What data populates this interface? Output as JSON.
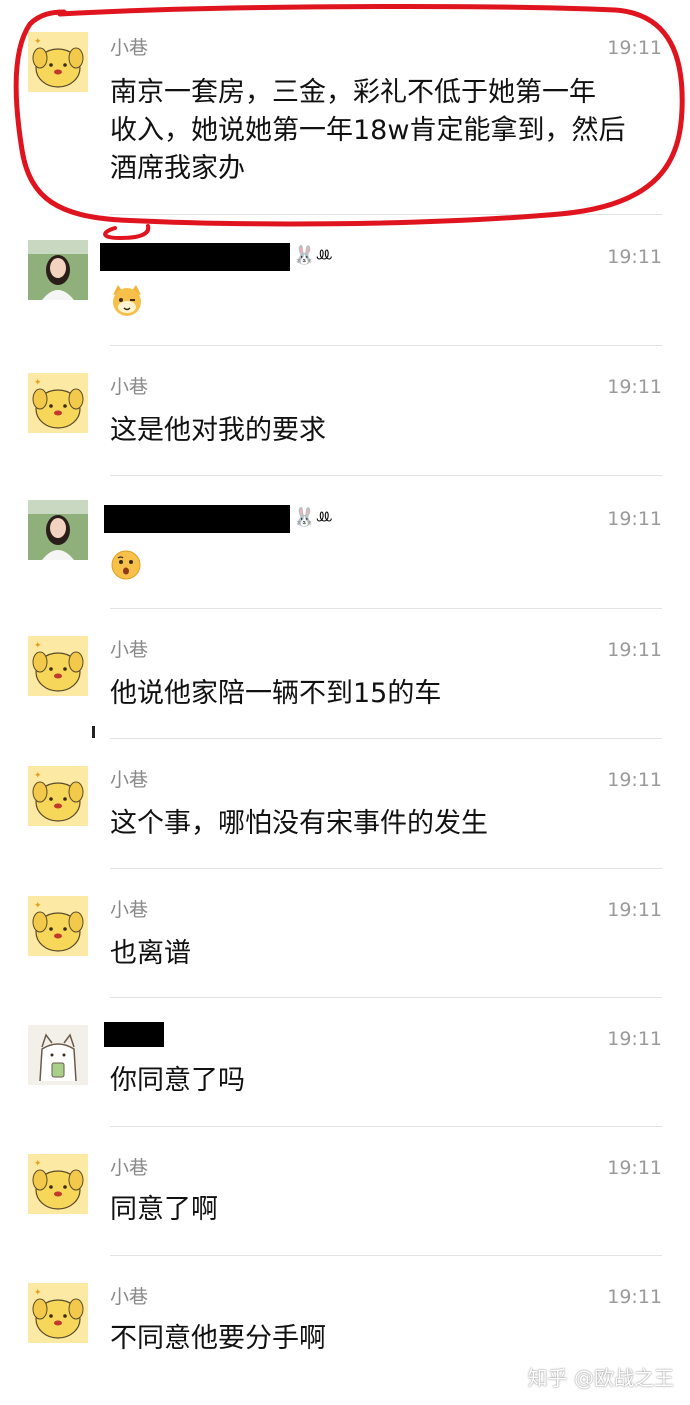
{
  "colors": {
    "annotation_red": "#e0141e",
    "sender_gray": "#8a8a8a",
    "time_gray": "#9a9a9a",
    "text": "#111111",
    "divider": "#e3e3e3"
  },
  "messages": [
    {
      "sender": "小巷",
      "time": "19:11",
      "lines": [
        "南京一套房，三金，彩礼不低于她第一年",
        "收入，她说她第一年18w肯定能拿到，然后",
        "酒席我家办"
      ],
      "avatar": "yellow-dog-avatar"
    },
    {
      "sender": "",
      "time": "19:11",
      "emoji": "cat-face-emoji",
      "avatar": "girl-photo-avatar",
      "name_tag": "🐰ꔛ"
    },
    {
      "sender": "小巷",
      "time": "19:11",
      "lines": [
        "这是他对我的要求"
      ],
      "avatar": "yellow-dog-avatar"
    },
    {
      "sender": "",
      "time": "19:11",
      "emoji": "surprised-face-emoji",
      "avatar": "girl-photo-avatar",
      "name_tag": "🐰ꔛ"
    },
    {
      "sender": "小巷",
      "time": "19:11",
      "lines": [
        "他说他家陪一辆不到15的车"
      ],
      "avatar": "yellow-dog-avatar"
    },
    {
      "sender": "小巷",
      "time": "19:11",
      "lines": [
        "这个事，哪怕没有宋事件的发生"
      ],
      "avatar": "yellow-dog-avatar"
    },
    {
      "sender": "小巷",
      "time": "19:11",
      "lines": [
        "也离谱"
      ],
      "avatar": "yellow-dog-avatar"
    },
    {
      "sender": "",
      "time": "19:11",
      "lines": [
        "你同意了吗"
      ],
      "avatar": "sketch-cat-avatar"
    },
    {
      "sender": "小巷",
      "time": "19:11",
      "lines": [
        "同意了啊"
      ],
      "avatar": "yellow-dog-avatar"
    },
    {
      "sender": "小巷",
      "time": "19:11",
      "lines": [
        "不同意他要分手啊"
      ],
      "avatar": "yellow-dog-avatar"
    }
  ],
  "watermark": "知乎 @欧战之王"
}
